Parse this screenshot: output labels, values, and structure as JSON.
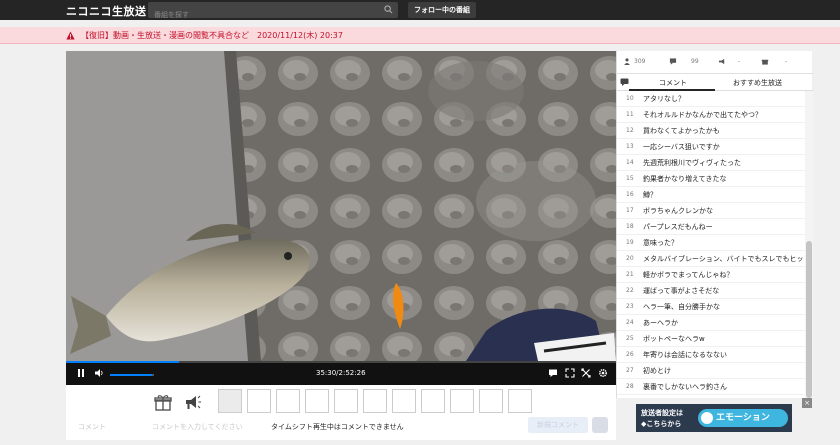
{
  "header": {
    "logo": "ニコニコ生放送",
    "search_placeholder": "番組を探す",
    "follow_button": "フォロー中の番組"
  },
  "alert": {
    "text": "【復旧】動画・生放送・漫画の閲覧不具合など　2020/11/12(木) 20:37"
  },
  "player": {
    "time": "35:30/2:52:26",
    "progress": 0.206,
    "volume": 0.95
  },
  "below": {
    "notice": "タイムシフト再生中はコメントできません",
    "faded_left": "コメント",
    "faded_mid": "コメントを入力してください",
    "faded_button": "新規コメント"
  },
  "sidebar": {
    "stats": [
      {
        "icon": "person-icon",
        "value": "309"
      },
      {
        "icon": "comment-icon",
        "value": "99"
      },
      {
        "icon": "ad-icon",
        "value": "-"
      },
      {
        "icon": "gift-icon",
        "value": "-"
      },
      {
        "icon": "trophy-icon",
        "value": "-"
      }
    ],
    "tabs": [
      "コメント",
      "おすすめ生放送"
    ],
    "comments": [
      {
        "n": "10",
        "t": "アタリなし？"
      },
      {
        "n": "11",
        "t": "それオルルドかなんかで出てたやつ？"
      },
      {
        "n": "12",
        "t": "買わなくてよかったかも"
      },
      {
        "n": "13",
        "t": "一応シーバス狙いですか"
      },
      {
        "n": "14",
        "t": "先週荒利根川でヴィヴィたった"
      },
      {
        "n": "15",
        "t": "釣果者かなり増えてきたな"
      },
      {
        "n": "16",
        "t": "鱒？"
      },
      {
        "n": "17",
        "t": "ボラちゃんクレンかな"
      },
      {
        "n": "18",
        "t": "パープレスだもんねー"
      },
      {
        "n": "19",
        "t": "意味った？"
      },
      {
        "n": "20",
        "t": "メタルバイブレーション、バイトでもスレでもヒット率高い"
      },
      {
        "n": "21",
        "t": "軽かボラでまってんじゃね？"
      },
      {
        "n": "22",
        "t": "運ばって事がよさそだな"
      },
      {
        "n": "23",
        "t": "ヘラ一筆、自分勝手かな"
      },
      {
        "n": "24",
        "t": "あーヘラか"
      },
      {
        "n": "25",
        "t": "ボットペーなヘラw"
      },
      {
        "n": "26",
        "t": "年寄りは会話になるなない"
      },
      {
        "n": "27",
        "t": "初めとけ"
      },
      {
        "n": "28",
        "t": "裏番でしかないヘラ釣さん"
      }
    ]
  },
  "ad": {
    "line1": "放送者設定は",
    "line2": "◆こちらから",
    "logo": "エモーション"
  },
  "colors": {
    "topbar": "#252525",
    "alert_bg": "#fadadd",
    "alert_text": "#c2102a",
    "progress": "#0080ff"
  }
}
